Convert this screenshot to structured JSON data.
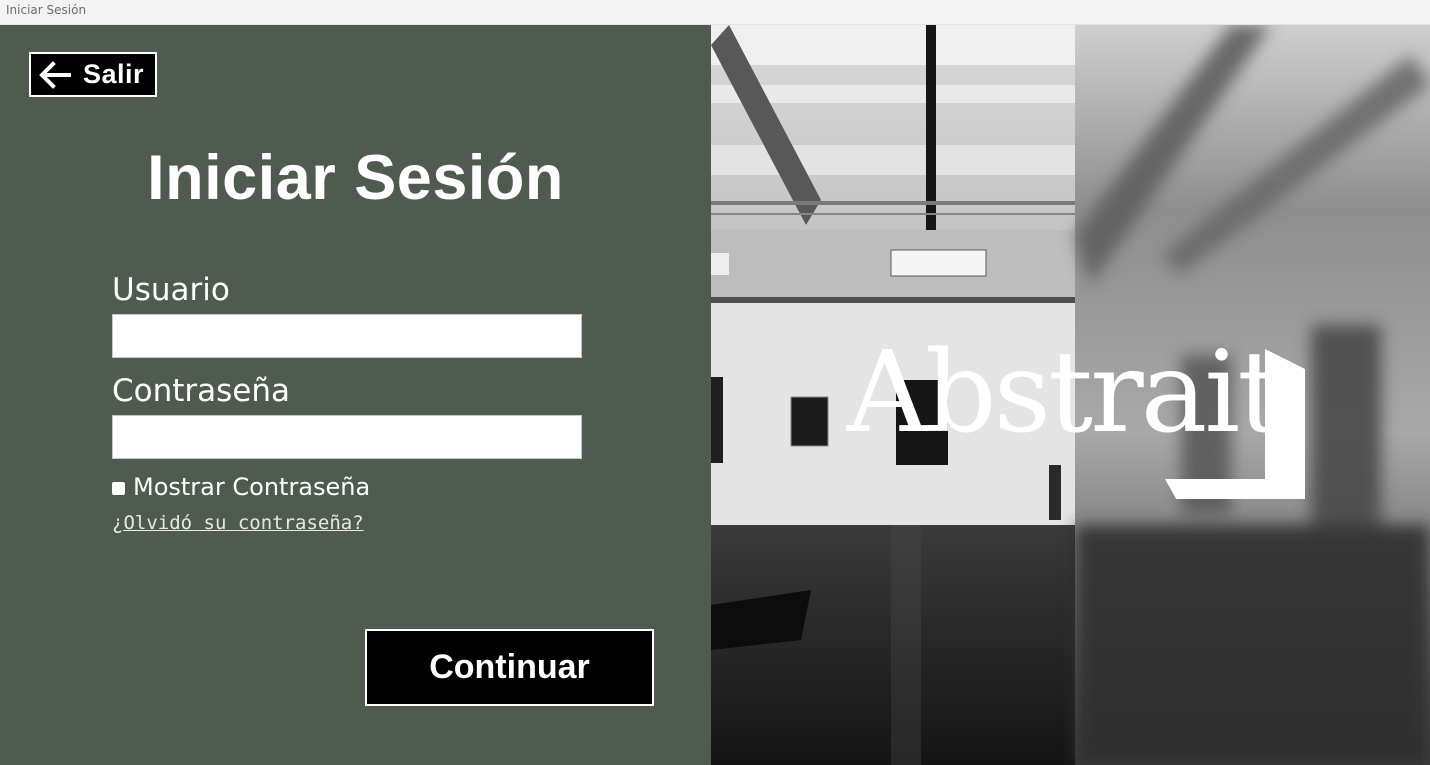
{
  "window": {
    "title": "Iniciar Sesión"
  },
  "back_button": {
    "label": "Salir",
    "icon": "arrow-left-icon"
  },
  "page_title": "Iniciar Sesión",
  "form": {
    "username": {
      "label": "Usuario",
      "value": ""
    },
    "password": {
      "label": "Contraseña",
      "value": ""
    },
    "show_password": {
      "label": "Mostrar Contraseña",
      "checked": false
    },
    "forgot_link": "¿Olvidó su contraseña?",
    "submit_label": "Continuar"
  },
  "brand": {
    "logo_text": "Abstrait"
  },
  "colors": {
    "panel_bg": "#505b4f",
    "button_bg": "#000000",
    "text": "#ffffff"
  }
}
